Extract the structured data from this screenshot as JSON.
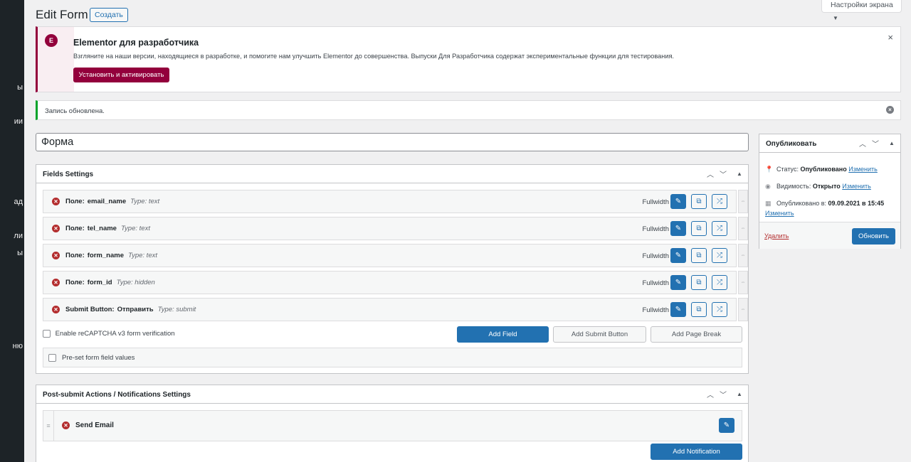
{
  "sidebar": {
    "fragments": [
      "ы",
      "ии",
      "ад",
      "ли",
      "ы",
      "ню"
    ]
  },
  "header": {
    "title": "Edit Form",
    "create_label": "Создать",
    "screen_options": "Настройки экрана"
  },
  "elementor_notice": {
    "title": "Elementor для разработчика",
    "text": "Взгляните на наши версии, находящиеся в разработке, и помогите нам улучшить Elementor до совершенства. Выпуски Для Разработчика содержат экспериментальные функции для тестирования.",
    "button": "Установить и активировать",
    "close": "×"
  },
  "updated_notice": {
    "text": "Запись обновлена."
  },
  "form_title": "Форма",
  "fields_settings": {
    "title": "Fields Settings",
    "fields": [
      {
        "prefix": "Поле:",
        "name": "email_name",
        "type": "Type: text",
        "width": "Fullwidth"
      },
      {
        "prefix": "Поле:",
        "name": "tel_name",
        "type": "Type: text",
        "width": "Fullwidth"
      },
      {
        "prefix": "Поле:",
        "name": "form_name",
        "type": "Type: text",
        "width": "Fullwidth"
      },
      {
        "prefix": "Поле:",
        "name": "form_id",
        "type": "Type: hidden",
        "width": "Fullwidth"
      },
      {
        "prefix": "Submit Button:",
        "name": "Отправить",
        "type": "Type: submit",
        "width": "Fullwidth"
      }
    ],
    "recaptcha_label": "Enable reCAPTCHA v3 form verification",
    "add_field": "Add Field",
    "add_submit": "Add Submit Button",
    "add_page_break": "Add Page Break",
    "preset_label": "Pre-set form field values"
  },
  "post_submit": {
    "title": "Post-submit Actions / Notifications Settings",
    "action": "Send Email",
    "add_notification": "Add Notification"
  },
  "publish": {
    "title": "Опубликовать",
    "status_label": "Статус:",
    "status_value": "Опубликовано",
    "visibility_label": "Видимость:",
    "visibility_value": "Открыто",
    "published_label": "Опубликовано в:",
    "published_value": "09.09.2021 в 15:45",
    "edit_link": "Изменить",
    "delete_label": "Удалить",
    "update_label": "Обновить"
  },
  "colors": {
    "primary": "#2271b1",
    "elementor": "#93003c",
    "success": "#00a32a",
    "error": "#b32d2e"
  }
}
